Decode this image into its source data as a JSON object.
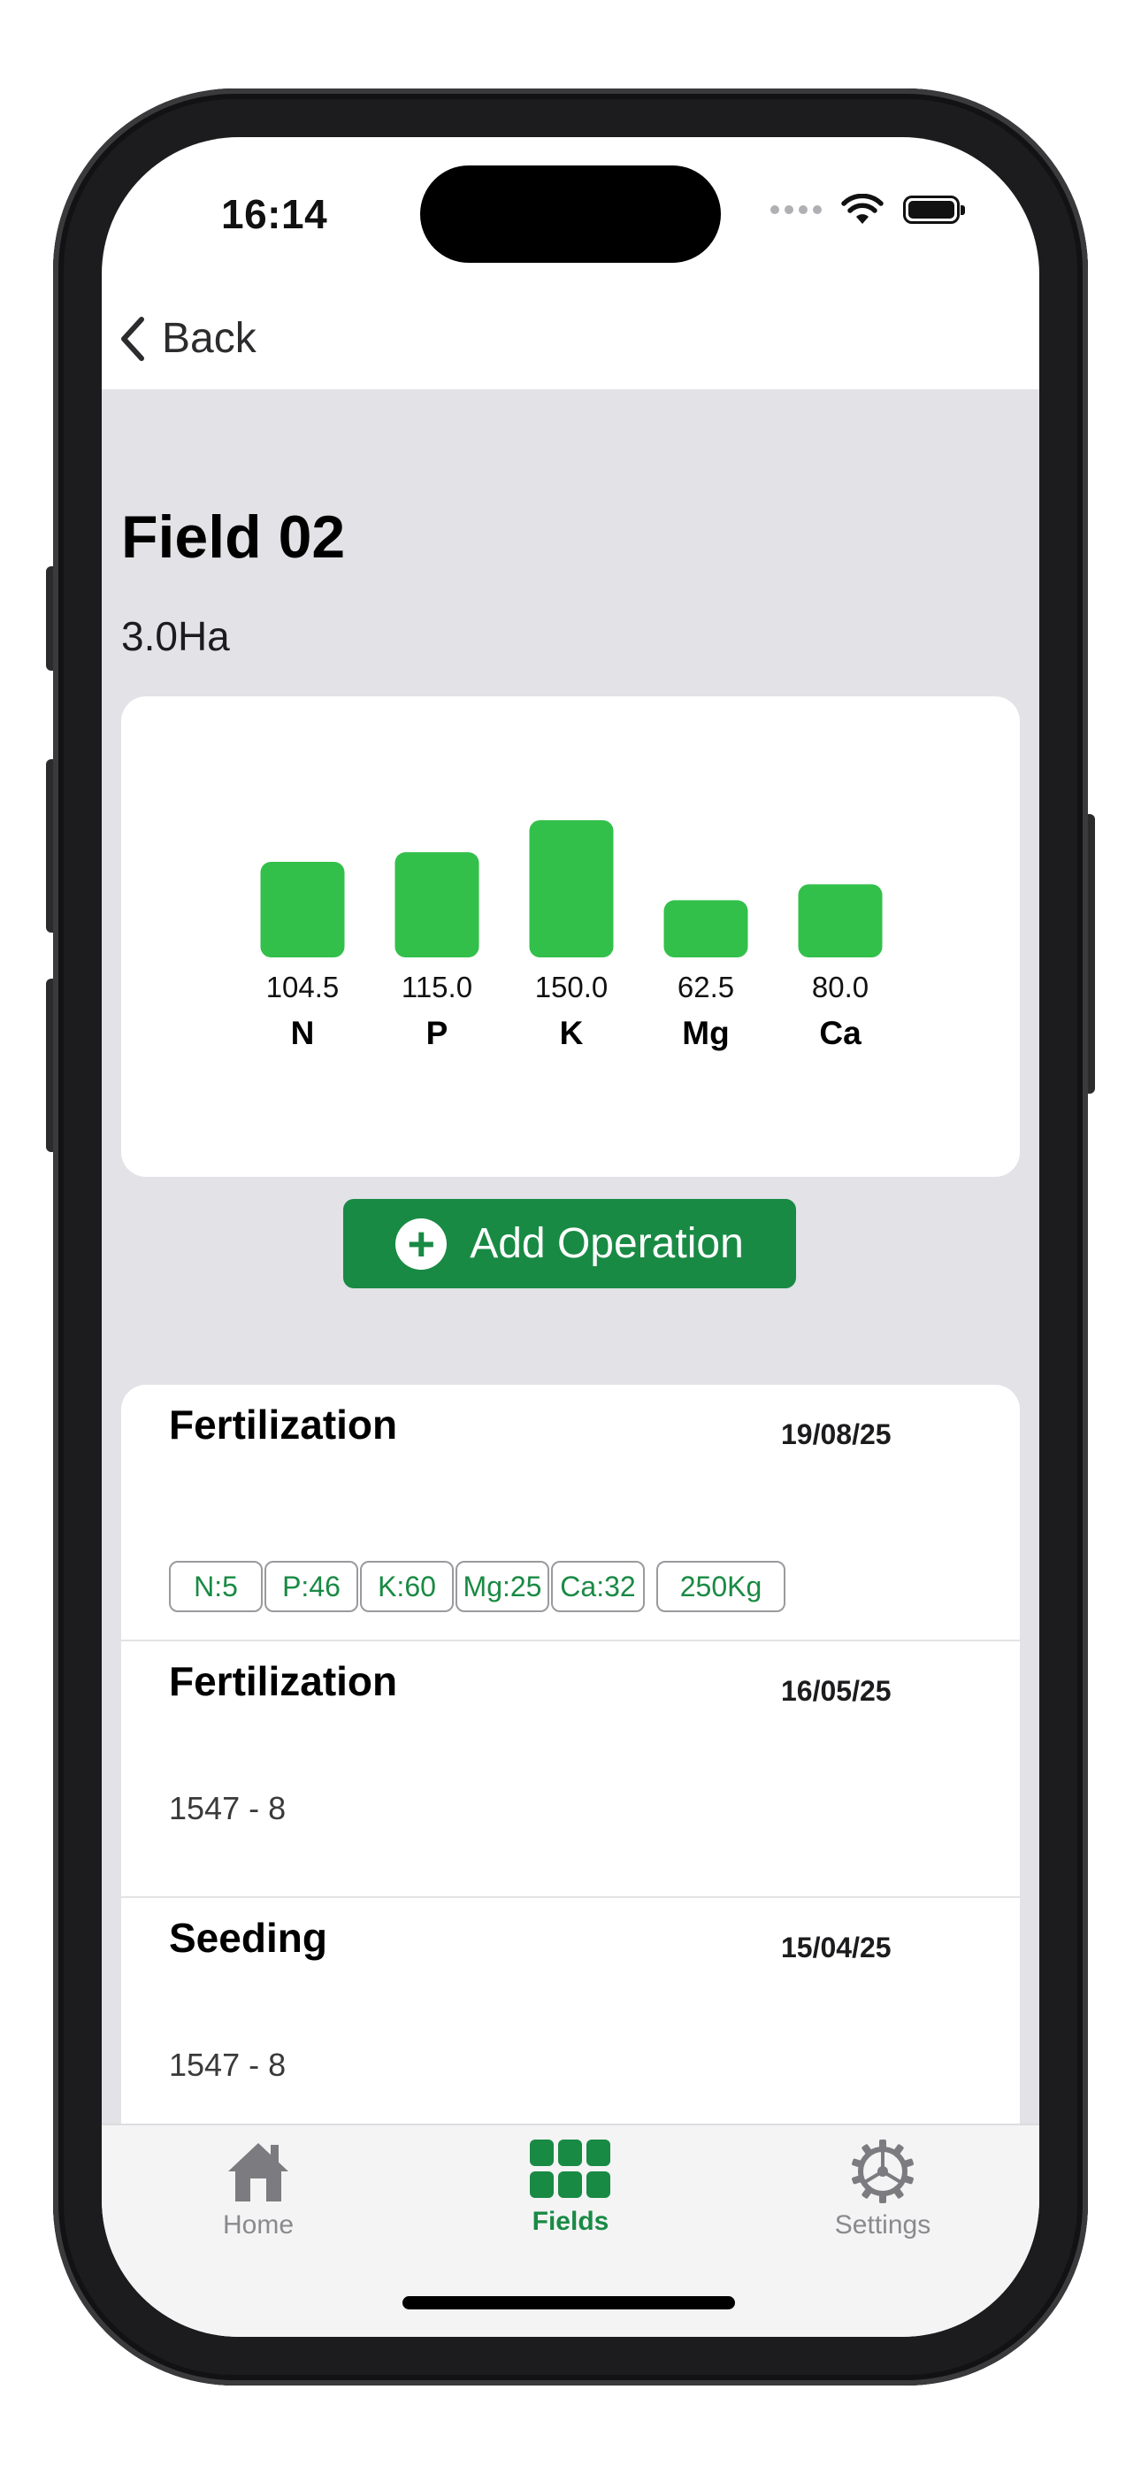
{
  "status_bar": {
    "time": "16:14"
  },
  "nav": {
    "back_label": "Back"
  },
  "field": {
    "name": "Field 02",
    "area": "3.0Ha"
  },
  "chart_data": {
    "type": "bar",
    "categories": [
      "N",
      "P",
      "K",
      "Mg",
      "Ca"
    ],
    "values": [
      104.5,
      115.0,
      150.0,
      62.5,
      80.0
    ],
    "value_labels": [
      "104.5",
      "115.0",
      "150.0",
      "62.5",
      "80.0"
    ],
    "ylim": [
      0,
      150
    ],
    "grid": false,
    "bar_color": "#32c04a"
  },
  "add_operation": {
    "label": "Add Operation"
  },
  "operations": [
    {
      "title": "Fertilization",
      "date": "19/08/25",
      "chips": [
        "N:5",
        "P:46",
        "K:60",
        "Mg:25",
        "Ca:32",
        "250Kg"
      ]
    },
    {
      "title": "Fertilization",
      "date": "16/05/25",
      "subtitle": "1547 -  8"
    },
    {
      "title": "Seeding",
      "date": "15/04/25",
      "subtitle": "1547 -  8"
    }
  ],
  "tabs": [
    {
      "label": "Home",
      "icon": "house-icon",
      "active": false
    },
    {
      "label": "Fields",
      "icon": "grid-icon",
      "active": true
    },
    {
      "label": "Settings",
      "icon": "gear-icon",
      "active": false
    }
  ],
  "colors": {
    "accent": "#198a44",
    "bar": "#32c04a",
    "background": "#e2e2e7"
  }
}
